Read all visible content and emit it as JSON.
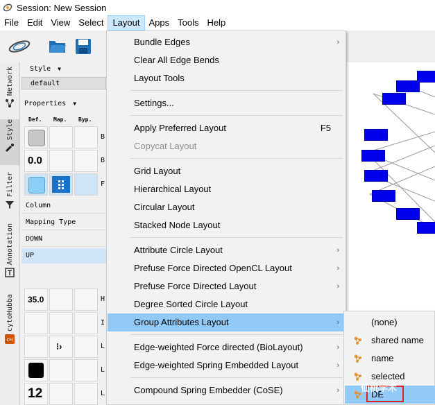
{
  "window": {
    "title": "Session: New Session"
  },
  "menubar": {
    "items": [
      "File",
      "Edit",
      "View",
      "Select",
      "Layout",
      "Apps",
      "Tools",
      "Help"
    ]
  },
  "sidetabs": [
    "Network",
    "Style",
    "Filter",
    "Annotation",
    "cytoHubba"
  ],
  "panel": {
    "style_label": "Style",
    "style_value": "default",
    "properties_label": "Properties",
    "col_def": "Def.",
    "col_map": "Map.",
    "col_byp": "Byp.",
    "rows": [
      {
        "def": "",
        "trunc": "B"
      },
      {
        "def": "0.0",
        "trunc": "B"
      },
      {
        "def": "",
        "trunc": "F"
      }
    ],
    "mapping": {
      "column": "Column",
      "mapping_type": "Mapping Type",
      "down": "DOWN",
      "up": "UP"
    },
    "rows2": [
      {
        "def": "35.0",
        "trunc": "H"
      },
      {
        "def": "",
        "trunc": "I"
      },
      {
        "def": "",
        "trunc": "L"
      },
      {
        "def": "",
        "trunc": "L"
      },
      {
        "def": "12",
        "trunc": "L"
      }
    ]
  },
  "layout_menu": {
    "items": [
      {
        "label": "Bundle Edges",
        "arrow": "›"
      },
      {
        "label": "Clear All Edge Bends"
      },
      {
        "label": "Layout Tools"
      },
      {
        "label": "Settings..."
      },
      {
        "label": "Apply Preferred Layout",
        "shortcut": "F5"
      },
      {
        "label": "Copycat Layout"
      },
      {
        "label": "Grid Layout"
      },
      {
        "label": "Hierarchical Layout"
      },
      {
        "label": "Circular Layout"
      },
      {
        "label": "Stacked Node Layout"
      },
      {
        "label": "Attribute Circle Layout",
        "arrow": "›"
      },
      {
        "label": "Prefuse Force Directed OpenCL Layout",
        "arrow": "›"
      },
      {
        "label": "Prefuse Force Directed Layout",
        "arrow": "›"
      },
      {
        "label": "Degree Sorted Circle Layout"
      },
      {
        "label": "Group Attributes Layout",
        "arrow": "›"
      },
      {
        "label": "Edge-weighted Force directed (BioLayout)",
        "arrow": "›"
      },
      {
        "label": "Edge-weighted Spring Embedded Layout",
        "arrow": "›"
      },
      {
        "label": "Compound Spring Embedder (CoSE)",
        "arrow": "›"
      }
    ]
  },
  "submenu": {
    "items": [
      "(none)",
      "shared name",
      "name",
      "selected",
      "DE"
    ]
  },
  "watermark": "仙桃学术",
  "colors": {
    "highlight": "#91c9f7",
    "node": "#0000ee",
    "accent_red": "#e02020"
  }
}
